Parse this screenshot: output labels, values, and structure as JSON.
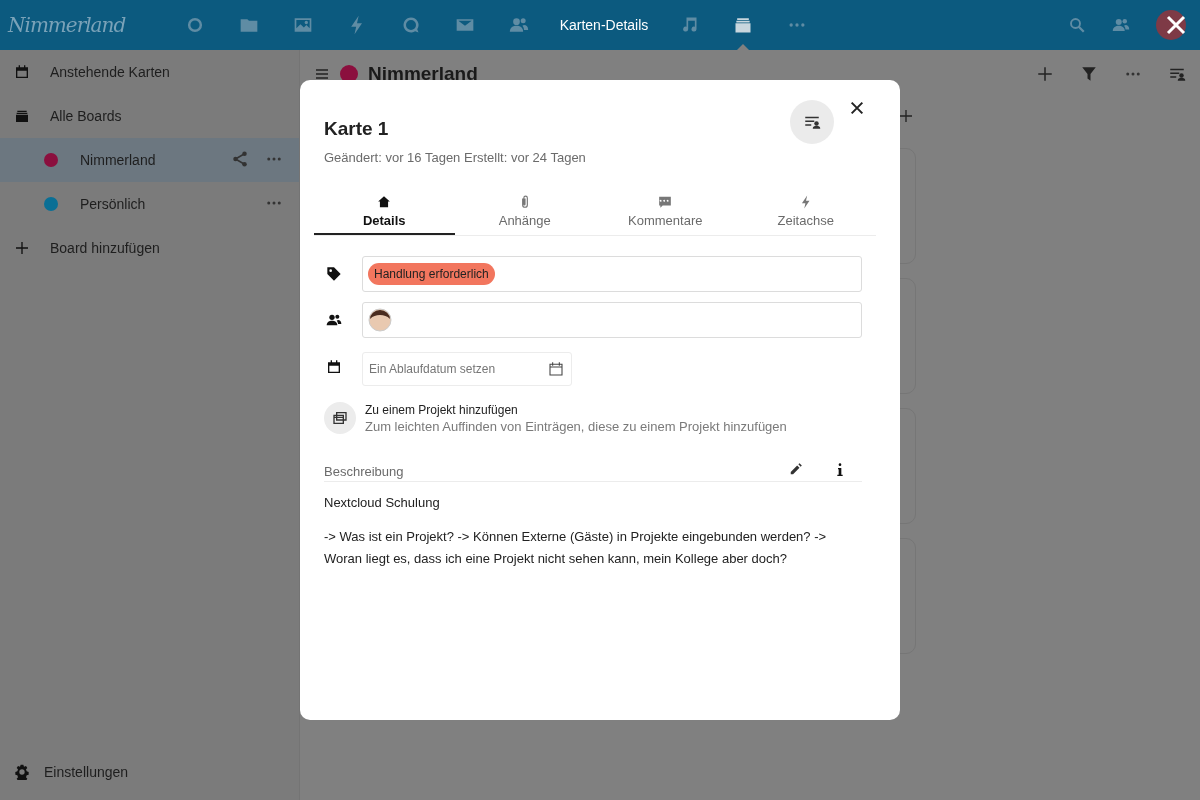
{
  "header": {
    "logo": "Nimmerland",
    "title": "Karten-Details",
    "apps_left": [
      {
        "kind": "circle",
        "selected": false
      },
      {
        "kind": "folder",
        "selected": false
      },
      {
        "kind": "image",
        "selected": false
      },
      {
        "kind": "bolt",
        "selected": false
      },
      {
        "kind": "talk",
        "selected": false
      },
      {
        "kind": "mail",
        "selected": false
      },
      {
        "kind": "contacts",
        "selected": false
      }
    ],
    "apps_right": [
      {
        "kind": "music",
        "selected": false
      },
      {
        "kind": "deck",
        "selected": true
      },
      {
        "kind": "more",
        "selected": false
      }
    ]
  },
  "sidebar": {
    "items": [
      {
        "kind": "upcoming",
        "label": "Anstehende Karten"
      },
      {
        "kind": "boards",
        "label": "Alle Boards"
      },
      {
        "kind": "board",
        "label": "Nimmerland",
        "color": "#8b0f3e",
        "selected": true,
        "shared": true
      },
      {
        "kind": "board",
        "label": "Persönlich",
        "color": "#0a6f95",
        "selected": false,
        "shared": false
      },
      {
        "kind": "add",
        "label": "Board hinzufügen"
      }
    ],
    "settings": "Einstellungen"
  },
  "board": {
    "title": "Nimmerland",
    "color": "#8b0f3e"
  },
  "card": {
    "title": "Karte 1",
    "meta": "Geändert: vor 16 Tagen Erstellt: vor 24 Tagen",
    "tabs": [
      {
        "kind": "details",
        "label": "Details",
        "selected": true
      },
      {
        "kind": "attachments",
        "label": "Anhänge",
        "selected": false
      },
      {
        "kind": "comments",
        "label": "Kommentare",
        "selected": false
      },
      {
        "kind": "timeline",
        "label": "Zeitachse",
        "selected": false
      }
    ],
    "tags": [
      {
        "label": "Handlung erforderlich",
        "color": "#f2765e"
      }
    ],
    "due_placeholder": "Ein Ablaufdatum setzen",
    "project": {
      "title": "Zu einem Projekt hinzufügen",
      "hint": "Zum leichten Auffinden von Einträgen, diese zu einem Projekt hinzufügen"
    },
    "description": {
      "label": "Beschreibung",
      "paragraphs": [
        "Nextcloud Schulung",
        "-> Was ist ein Projekt? -> Können Externe (Gäste) in Projekte eingebunden werden? -> Woran liegt es, dass ich eine Projekt nicht sehen kann, mein Kollege aber doch?"
      ]
    }
  }
}
